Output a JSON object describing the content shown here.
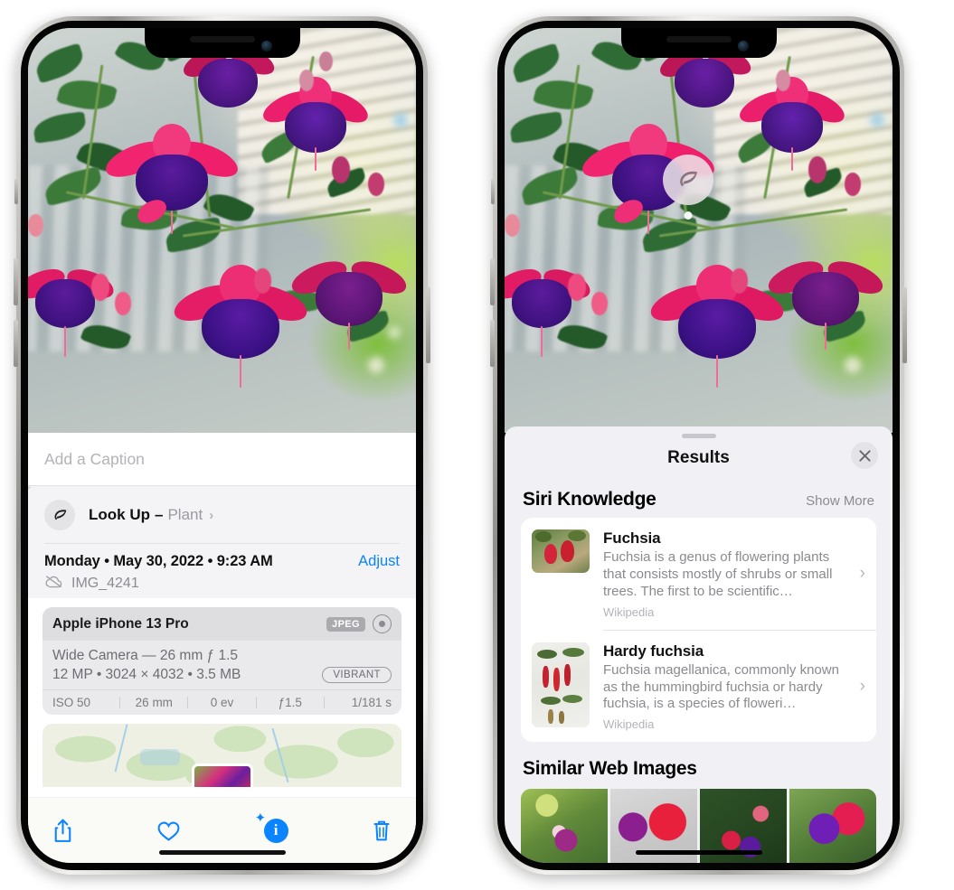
{
  "left_phone": {
    "caption": {
      "placeholder": "Add a Caption",
      "value": ""
    },
    "lookup": {
      "label": "Look Up",
      "dash": "–",
      "subject": "Plant",
      "chevron": "›",
      "icon": "leaf-icon",
      "sparkle": "✦"
    },
    "meta": {
      "date": "Monday • May 30, 2022 • 9:23 AM",
      "adjust_label": "Adjust",
      "filename": "IMG_4241",
      "cloud_icon": "icloud-slash-icon"
    },
    "exif_card": {
      "device": "Apple iPhone 13 Pro",
      "format_badge": "JPEG",
      "lens_icon": "camera-lens-icon",
      "lens_line": "Wide Camera — 26 mm ƒ 1.5",
      "spec_line": "12 MP • 3024 × 4032 • 3.5 MB",
      "style_badge": "VIBRANT",
      "footer": [
        "ISO 50",
        "26 mm",
        "0 ev",
        "ƒ1.5",
        "1/181 s"
      ]
    },
    "toolbar": [
      {
        "name": "share-button",
        "icon": "share-icon"
      },
      {
        "name": "favorite-button",
        "icon": "heart-icon"
      },
      {
        "name": "info-button",
        "icon": "info-sparkle-icon",
        "glyph": "i"
      },
      {
        "name": "delete-button",
        "icon": "trash-icon"
      }
    ]
  },
  "right_phone": {
    "visual_lookup_badge": {
      "icon": "leaf-icon"
    },
    "sheet": {
      "title": "Results",
      "close_icon": "close-icon",
      "sections": [
        {
          "title": "Siri Knowledge",
          "action": "Show More",
          "entries": [
            {
              "title": "Fuchsia",
              "description": "Fuchsia is a genus of flowering plants that consists mostly of shrubs or small trees. The first to be scientific…",
              "source": "Wikipedia",
              "chevron": "›"
            },
            {
              "title": "Hardy fuchsia",
              "description": "Fuchsia magellanica, commonly known as the hummingbird fuchsia or hardy fuchsia, is a species of floweri…",
              "source": "Wikipedia",
              "chevron": "›"
            }
          ]
        },
        {
          "title": "Similar Web Images",
          "images": [
            {
              "name": "similar-image-1"
            },
            {
              "name": "similar-image-2"
            },
            {
              "name": "similar-image-3"
            },
            {
              "name": "similar-image-4"
            }
          ]
        }
      ]
    }
  },
  "colors": {
    "accent_blue": "#0a84ff",
    "sheet_bg": "#f1f1f5",
    "card_bg": "#eaeaec",
    "secondary_text": "#8a8a90"
  }
}
